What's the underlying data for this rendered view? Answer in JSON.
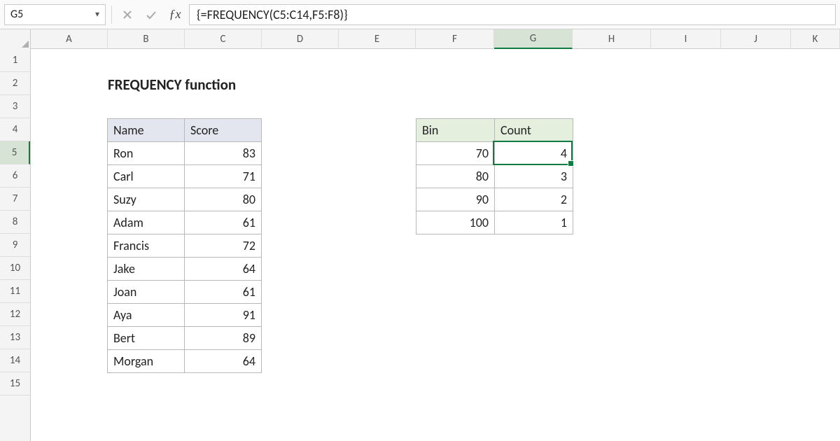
{
  "nameBox": "G5",
  "formula": "{=FREQUENCY(C5:C14,F5:F8)}",
  "title": "FREQUENCY function",
  "columns": [
    "A",
    "B",
    "C",
    "D",
    "E",
    "F",
    "G",
    "H",
    "I",
    "J",
    "K"
  ],
  "rows": [
    "1",
    "2",
    "3",
    "4",
    "5",
    "6",
    "7",
    "8",
    "9",
    "10",
    "11",
    "12",
    "13",
    "14",
    "15"
  ],
  "selectedCol": "G",
  "selectedRow": "5",
  "table1": {
    "headers": {
      "name": "Name",
      "score": "Score"
    },
    "rows": [
      {
        "name": "Ron",
        "score": "83"
      },
      {
        "name": "Carl",
        "score": "71"
      },
      {
        "name": "Suzy",
        "score": "80"
      },
      {
        "name": "Adam",
        "score": "61"
      },
      {
        "name": "Francis",
        "score": "72"
      },
      {
        "name": "Jake",
        "score": "64"
      },
      {
        "name": "Joan",
        "score": "61"
      },
      {
        "name": "Aya",
        "score": "91"
      },
      {
        "name": "Bert",
        "score": "89"
      },
      {
        "name": "Morgan",
        "score": "64"
      }
    ]
  },
  "table2": {
    "headers": {
      "bin": "Bin",
      "count": "Count"
    },
    "rows": [
      {
        "bin": "70",
        "count": "4"
      },
      {
        "bin": "80",
        "count": "3"
      },
      {
        "bin": "90",
        "count": "2"
      },
      {
        "bin": "100",
        "count": "1"
      }
    ]
  }
}
